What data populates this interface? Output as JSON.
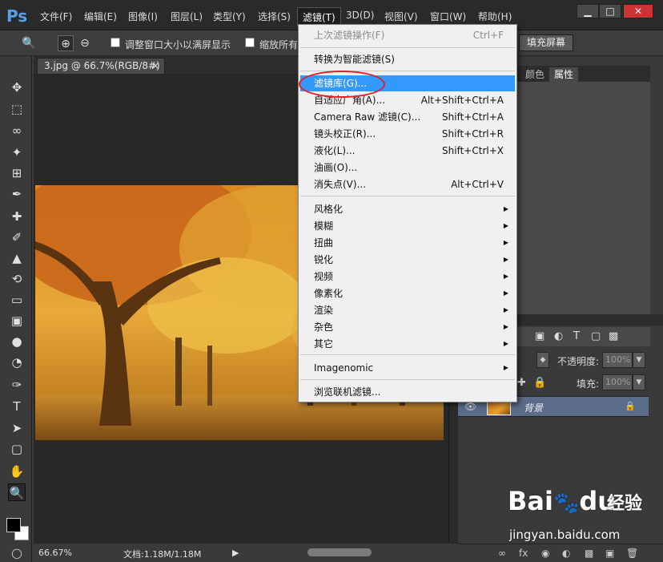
{
  "app": {
    "logo": "Ps"
  },
  "menubar": {
    "items": [
      "文件(F)",
      "编辑(E)",
      "图像(I)",
      "图层(L)",
      "类型(Y)",
      "选择(S)",
      "滤镜(T)",
      "3D(D)",
      "视图(V)",
      "窗口(W)",
      "帮助(H)"
    ],
    "active": "滤镜(T)",
    "window_buttons": {
      "minimize": "▁",
      "maximize": "□",
      "close": "✕"
    }
  },
  "options_bar": {
    "fit_window_label": "调整窗口大小以满屏显示",
    "zoom_all_label": "缩放所有",
    "fill_screen_label": "填充屏幕"
  },
  "document": {
    "tab_title": "3.jpg @ 66.7%(RGB/8#)",
    "tab_close": "×",
    "zoom": "66.67%",
    "doc_info": "文档:1.18M/1.18M"
  },
  "panels": {
    "tabs": [
      "颜色",
      "属性"
    ],
    "active_tab": "属性",
    "opacity_label": "不透明度:",
    "opacity_value": "100%",
    "fill_label": "填充:",
    "fill_value": "100%",
    "layer_name": "背景"
  },
  "filter_menu": {
    "items": [
      {
        "label": "上次滤镜操作(F)",
        "shortcut": "Ctrl+F",
        "disabled": true
      },
      {
        "label": "转换为智能滤镜(S)"
      },
      {
        "label": "滤镜库(G)...",
        "highlighted": true
      },
      {
        "label": "自适应广角(A)...",
        "shortcut": "Alt+Shift+Ctrl+A"
      },
      {
        "label": "Camera Raw 滤镜(C)...",
        "shortcut": "Shift+Ctrl+A"
      },
      {
        "label": "镜头校正(R)...",
        "shortcut": "Shift+Ctrl+R"
      },
      {
        "label": "液化(L)...",
        "shortcut": "Shift+Ctrl+X"
      },
      {
        "label": "油画(O)..."
      },
      {
        "label": "消失点(V)...",
        "shortcut": "Alt+Ctrl+V"
      },
      {
        "label": "风格化",
        "submenu": true
      },
      {
        "label": "模糊",
        "submenu": true
      },
      {
        "label": "扭曲",
        "submenu": true
      },
      {
        "label": "锐化",
        "submenu": true
      },
      {
        "label": "视频",
        "submenu": true
      },
      {
        "label": "像素化",
        "submenu": true
      },
      {
        "label": "渲染",
        "submenu": true
      },
      {
        "label": "杂色",
        "submenu": true
      },
      {
        "label": "其它",
        "submenu": true
      },
      {
        "label": "Imagenomic",
        "submenu": true
      },
      {
        "label": "浏览联机滤镜..."
      }
    ]
  },
  "watermark": {
    "logo": "Bai",
    "logo_suffix": "du",
    "cn": "经验",
    "url": "jingyan.baidu.com"
  }
}
